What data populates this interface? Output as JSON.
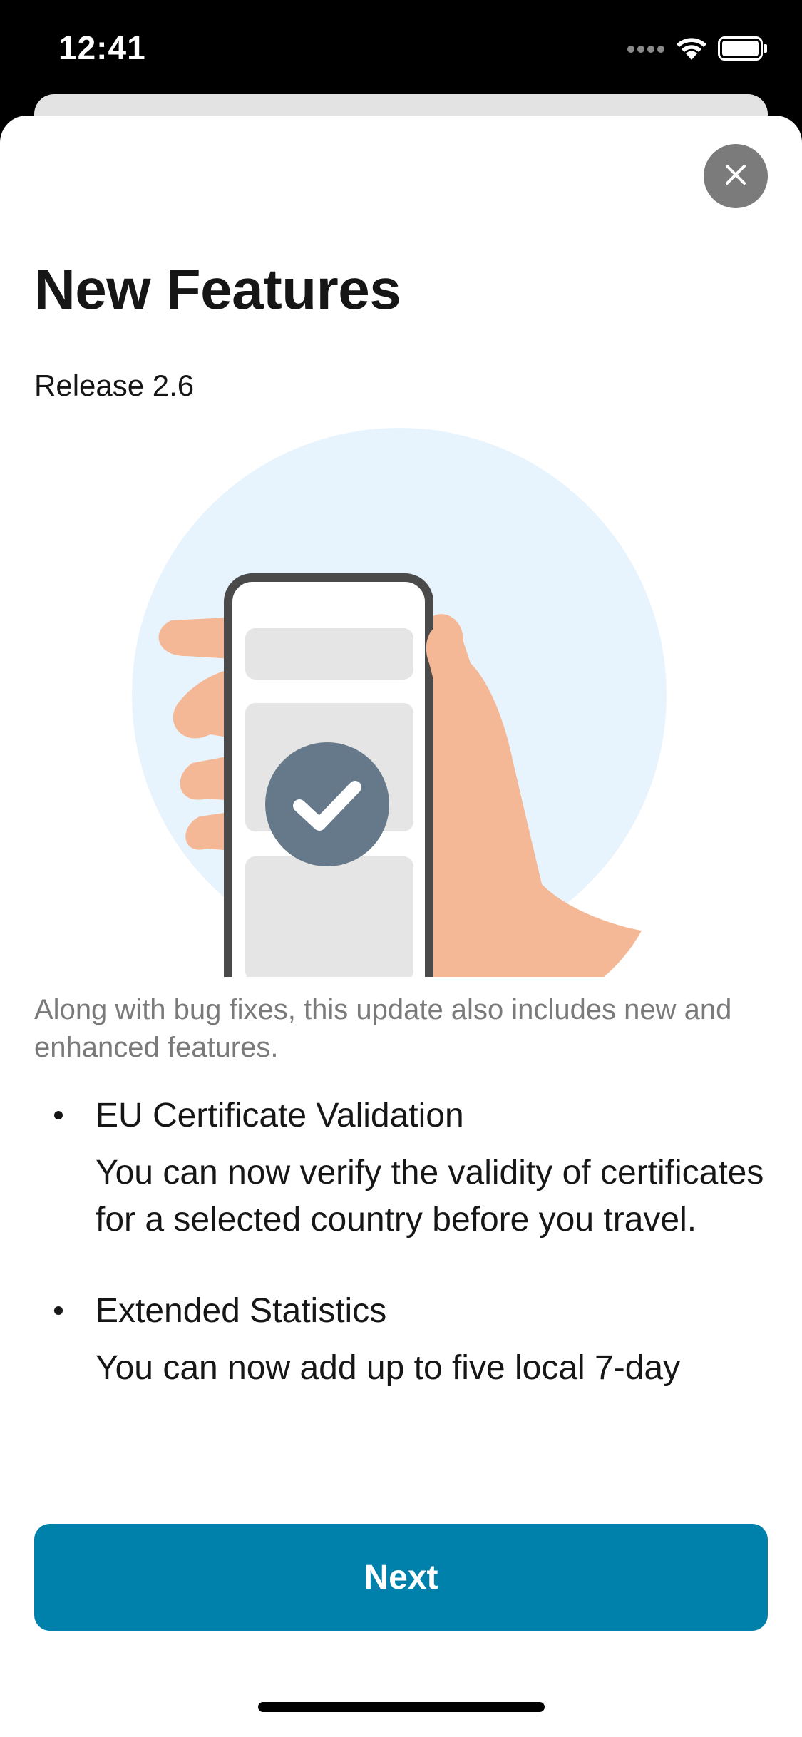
{
  "status_bar": {
    "time": "12:41",
    "icons": [
      "signal-dots-icon",
      "wifi-icon",
      "battery-icon"
    ]
  },
  "close_icon": "close-icon",
  "header": {
    "title": "New Features",
    "release": "Release 2.6"
  },
  "illustration": {
    "icon": "phone-check-illustration",
    "colors": {
      "circle": "#e8f4fd",
      "hand": "#f5b896",
      "phone_frame": "#4a4a4a",
      "check_badge": "#66798a"
    }
  },
  "intro": "Along with bug fixes, this update also includes new and enhanced features.",
  "features": [
    {
      "title": "EU Certificate Validation",
      "description": "You can now verify the validity of certificates for a selected country before you travel."
    },
    {
      "title": "Extended Statistics",
      "description": "You can now add up to five local 7-day"
    }
  ],
  "actions": {
    "next_label": "Next"
  },
  "colors": {
    "accent": "#0081ab",
    "close_button": "#7b7b7b",
    "text_primary": "#161616",
    "text_secondary": "#7a7a7a"
  }
}
